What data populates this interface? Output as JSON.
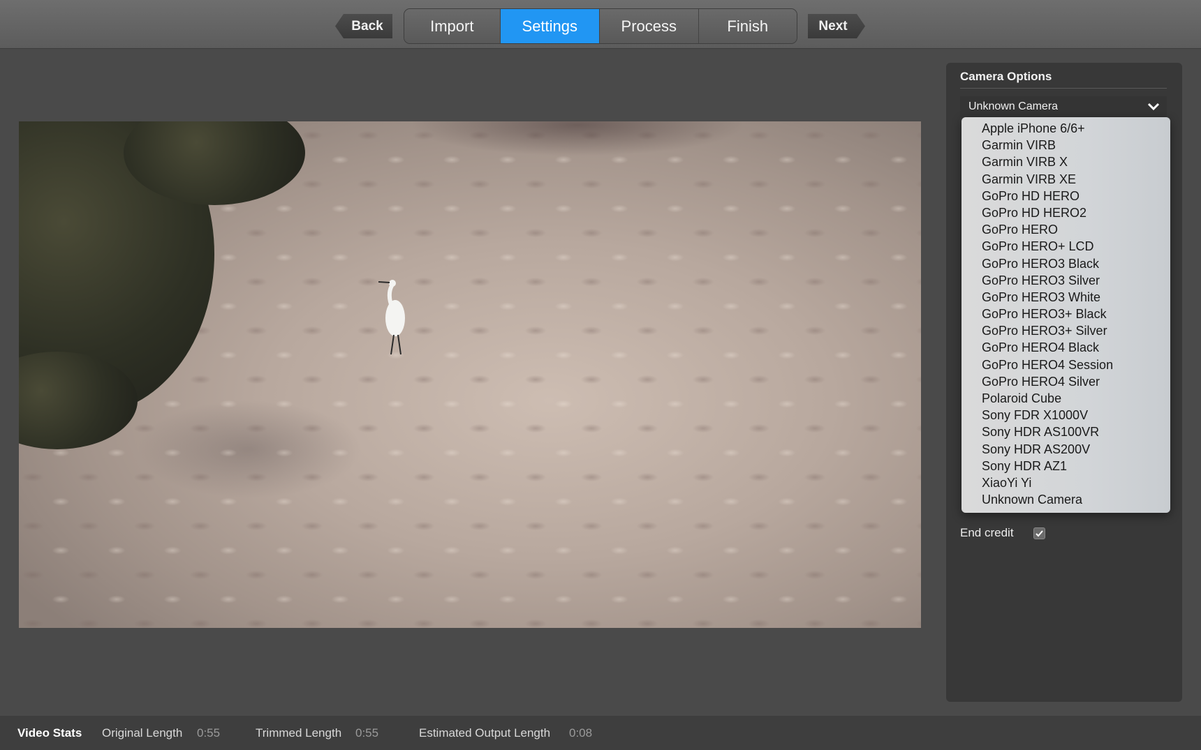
{
  "toolbar": {
    "back_label": "Back",
    "next_label": "Next",
    "tabs": [
      {
        "label": "Import"
      },
      {
        "label": "Settings",
        "active": true
      },
      {
        "label": "Process"
      },
      {
        "label": "Finish"
      }
    ],
    "accent_color": "#2196f3"
  },
  "panel": {
    "title": "Camera Options",
    "camera_select": {
      "value": "Unknown Camera",
      "icon": "chevron-down-icon"
    },
    "end_credit": {
      "label": "End credit",
      "checked": true
    }
  },
  "dropdown": {
    "options": [
      "Apple iPhone 6/6+",
      "Garmin VIRB",
      "Garmin VIRB X",
      "Garmin VIRB XE",
      "GoPro HD HERO",
      "GoPro HD HERO2",
      "GoPro HERO",
      "GoPro HERO+ LCD",
      "GoPro HERO3 Black",
      "GoPro HERO3 Silver",
      "GoPro HERO3 White",
      "GoPro HERO3+ Black",
      "GoPro HERO3+ Silver",
      "GoPro HERO4 Black",
      "GoPro HERO4 Session",
      "GoPro HERO4 Silver",
      "Polaroid Cube",
      "Sony FDR X1000V",
      "Sony HDR AS100VR",
      "Sony HDR AS200V",
      "Sony HDR AZ1",
      "XiaoYi Yi",
      "Unknown Camera"
    ]
  },
  "status": {
    "title": "Video Stats",
    "original_label": "Original Length",
    "original_value": "0:55",
    "trimmed_label": "Trimmed Length",
    "trimmed_value": "0:55",
    "estimated_label": "Estimated Output Length",
    "estimated_value": "0:08"
  }
}
